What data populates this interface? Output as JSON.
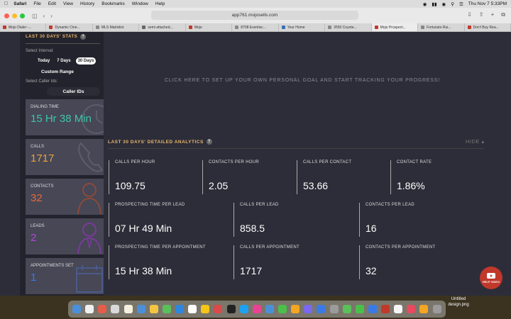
{
  "menubar": {
    "app": "Safari",
    "items": [
      "File",
      "Edit",
      "View",
      "History",
      "Bookmarks",
      "Window",
      "Help"
    ],
    "clock": "Thu Nov 7  5:33PM"
  },
  "browser": {
    "url": "app761.mojosells.com",
    "tabs": [
      {
        "label": "Mojo Dialer -...",
        "color": "#c0392b"
      },
      {
        "label": "Dynamic Cine...",
        "color": "#c0392b"
      },
      {
        "label": "MLS Matrixlist",
        "color": "#888888"
      },
      {
        "label": "semi attached...",
        "color": "#666666"
      },
      {
        "label": "Mojo",
        "color": "#c0392b"
      },
      {
        "label": "8708 Eventisc...",
        "color": "#888888"
      },
      {
        "label": "Your Home",
        "color": "#3a6fb0"
      },
      {
        "label": "3550 Coyote...",
        "color": "#888888"
      },
      {
        "label": "Mojo Prospect...",
        "color": "#c0392b"
      },
      {
        "label": "Fortunato Rui...",
        "color": "#888888"
      },
      {
        "label": "Don't Buy Rea...",
        "color": "#c0392b"
      }
    ]
  },
  "sidebar": {
    "heading": "LAST 30 DAYS' STATS",
    "help": "?",
    "interval_label": "Select Interval:",
    "intervals": [
      "Today",
      "7 Days",
      "30 Days"
    ],
    "custom_range": "Custom Range",
    "caller_label": "Select Caller Ids:",
    "caller_button": "Caller IDs",
    "cards": [
      {
        "title": "DIALING TIME",
        "value": "15 Hr 38 Min",
        "color": "#3ec6a8",
        "icon": "clock-icon"
      },
      {
        "title": "CALLS",
        "value": "1717",
        "color": "#e8a43a",
        "icon": "phone-icon"
      },
      {
        "title": "CONTACTS",
        "value": "32",
        "color": "#e86a3a",
        "icon": "person-icon"
      },
      {
        "title": "LEADS",
        "value": "2",
        "color": "#b04ad8",
        "icon": "businessman-icon"
      },
      {
        "title": "APPOINTMENTS SET",
        "value": "1",
        "color": "#3a7ae8",
        "icon": "calendar-icon"
      }
    ]
  },
  "main": {
    "goal_text": "CLICK HERE TO SET UP YOUR OWN PERSONAL GOAL AND START TRACKING YOUR PROGRESS!",
    "analytics_heading": "LAST 30 DAYS' DETAILED ANALYTICS",
    "help": "?",
    "hide_label": "HIDE ▴",
    "row1": [
      {
        "title": "CALLS PER HOUR",
        "value": "109.75"
      },
      {
        "title": "CONTACTS PER HOUR",
        "value": "2.05"
      },
      {
        "title": "CALLS PER CONTACT",
        "value": "53.66"
      },
      {
        "title": "CONTACT RATE",
        "value": "1.86%"
      }
    ],
    "row2": [
      {
        "title": "PROSPECTING TIME PER LEAD",
        "value": "07 Hr 49 Min"
      },
      {
        "title": "CALLS PER LEAD",
        "value": "858.5"
      },
      {
        "title": "CONTACTS PER LEAD",
        "value": "16"
      }
    ],
    "row3": [
      {
        "title": "PROSPECTING TIME PER APPOINTMENT",
        "value": "15 Hr 38 Min"
      },
      {
        "title": "CALLS PER APPOINTMENT",
        "value": "1717"
      },
      {
        "title": "CONTACTS PER APPOINTMENT",
        "value": "32"
      }
    ],
    "help_video": "HELP VIDEO"
  },
  "desktop": {
    "file_label": "Untitled design.png"
  },
  "dock_colors": [
    "#4a90d9",
    "#f0f0f0",
    "#e35d4a",
    "#d9d9d9",
    "#f4f0e0",
    "#4a90d9",
    "#f4c542",
    "#5ac05a",
    "#2e86de",
    "#ffffff",
    "#f5c518",
    "#d94a4a",
    "#222222",
    "#1da1f2",
    "#e84393",
    "#4a90d9",
    "#4ac04a",
    "#f5a623",
    "#7b68ee",
    "#3a7ae8",
    "#9b9b9b",
    "#5ac05a",
    "#4ac04a",
    "#3a7ae8",
    "#c0392b",
    "#f5f5f5",
    "#e84a5f",
    "#f5a623",
    "#9b9b9b"
  ]
}
